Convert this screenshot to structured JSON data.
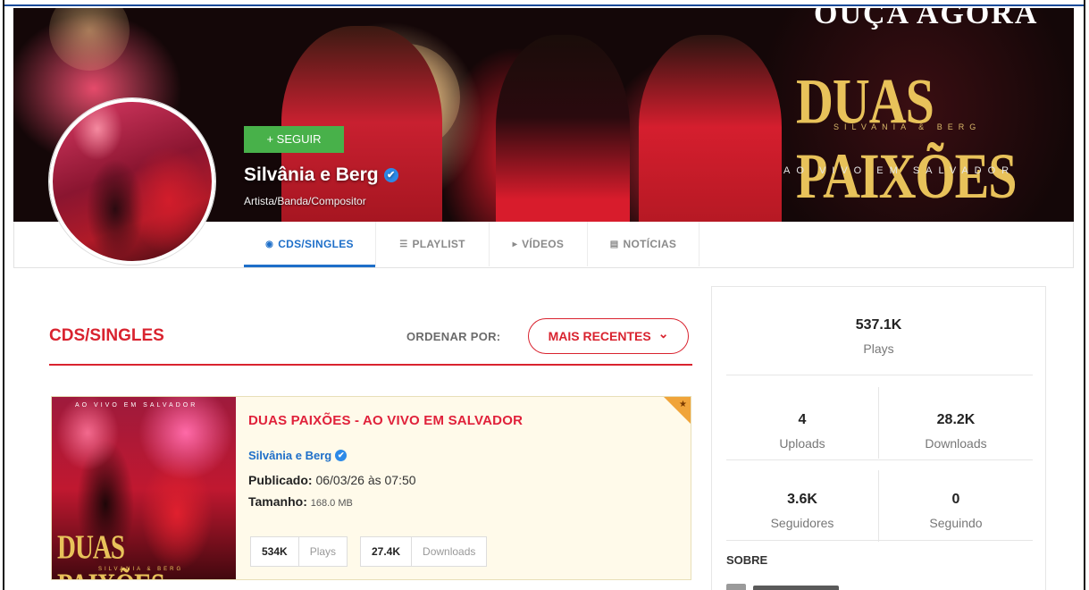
{
  "banner": {
    "headline_top": "OUÇA AGORA",
    "album_logo": "DUAS PAIXÕES",
    "album_logo_sub": "SILVANIA & BERG",
    "album_logo_live": "AO VIVO EM SALVADOR"
  },
  "profile": {
    "follow_label": "+ SEGUIR",
    "name": "Silvânia e Berg",
    "type": "Artista/Banda/Compositor",
    "verified_glyph": "✔"
  },
  "tabs": [
    {
      "label": "CDS/SINGLES",
      "icon": "disc-icon",
      "glyph": "◉",
      "active": true
    },
    {
      "label": "PLAYLIST",
      "icon": "list-icon",
      "glyph": "☰",
      "active": false
    },
    {
      "label": "VÍDEOS",
      "icon": "play-icon",
      "glyph": "▸",
      "active": false
    },
    {
      "label": "NOTÍCIAS",
      "icon": "news-icon",
      "glyph": "▤",
      "active": false
    }
  ],
  "main": {
    "section_title": "CDS/SINGLES",
    "sort_label": "ORDENAR POR:",
    "sort_value": "MAIS RECENTES",
    "sort_chevron": "⌄"
  },
  "release": {
    "cover_top_text": "AO VIVO EM SALVADOR",
    "cover_logo": "DUAS PAIXÕES",
    "cover_sub": "SILVANIA & BERG",
    "title": "DUAS PAIXÕES - AO VIVO EM SALVADOR",
    "artist": "Silvânia e Berg",
    "published_label": "Publicado:",
    "published_value": "06/03/26 às 07:50",
    "size_label": "Tamanho:",
    "size_value": "168.0 MB",
    "plays_count": "534K",
    "plays_label": "Plays",
    "downloads_count": "27.4K",
    "downloads_label": "Downloads",
    "star_glyph": "★"
  },
  "stats": {
    "plays_value": "537.1K",
    "plays_label": "Plays",
    "uploads_value": "4",
    "uploads_label": "Uploads",
    "downloads_value": "28.2K",
    "downloads_label": "Downloads",
    "followers_value": "3.6K",
    "followers_label": "Seguidores",
    "following_value": "0",
    "following_label": "Seguindo",
    "about_label": "SOBRE"
  },
  "colors": {
    "accent_red": "#d9232f",
    "link_blue": "#1e6fc9",
    "follow_green": "#48b14a",
    "card_bg": "#fffaea"
  }
}
